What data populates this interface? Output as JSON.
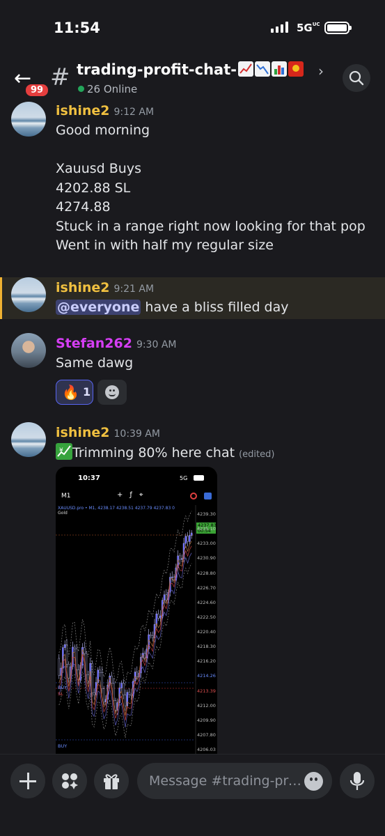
{
  "status": {
    "time": "11:54",
    "network": "5G",
    "network_suffix": "UC"
  },
  "header": {
    "back_icon": "arrow-left-icon",
    "unread_badge": "99",
    "channel_name": "trading-profit-chat-",
    "online_text": "26 Online",
    "online_color": "#23a55a"
  },
  "messages": [
    {
      "author": "ishine2",
      "author_color": "#f0c040",
      "time": "9:12 AM",
      "lines": [
        "Good morning",
        "",
        "Xauusd Buys",
        "4202.88 SL",
        "4274.88",
        "Stuck in a range right now looking for that pop",
        "Went in with half my regular size"
      ]
    },
    {
      "author": "ishine2",
      "author_color": "#f0c040",
      "time": "9:21 AM",
      "mention": "@everyone",
      "text": " have a bliss filled day"
    },
    {
      "author": "Stefan262",
      "author_color": "#d63ef5",
      "time": "9:30 AM",
      "text": "Same dawg",
      "reaction": {
        "emoji": "🔥",
        "count": "1"
      }
    },
    {
      "author": "ishine2",
      "author_color": "#f0c040",
      "time": "10:39 AM",
      "text": "Trimming 80% here chat",
      "edited": "(edited)"
    }
  ],
  "attachment": {
    "time": "10:37",
    "network": "5G",
    "timeframe": "M1",
    "symbol_line": "XAUUSD.pro • M1, 4238.17 4238.51 4237.79 4237.83 0",
    "instrument": "Gold",
    "current_price": "4237.83",
    "countdown": "00:54",
    "price_labels": [
      "4239.30",
      "4235.10",
      "4233.00",
      "4230.90",
      "4228.80",
      "4226.70",
      "4224.60",
      "4222.50",
      "4220.40",
      "4218.30",
      "4216.20",
      "4214.26",
      "4213.39",
      "4212.00",
      "4209.90",
      "4207.80",
      "4206.03"
    ],
    "buy_label": "BUY",
    "sl_label": "SL"
  },
  "composer": {
    "placeholder": "Message #trading-profit-chat-",
    "plus_icon": "plus-icon",
    "apps_icon": "apps-icon",
    "gift_icon": "gift-icon",
    "emoji_icon": "emoji-icon",
    "mic_icon": "microphone-icon"
  }
}
